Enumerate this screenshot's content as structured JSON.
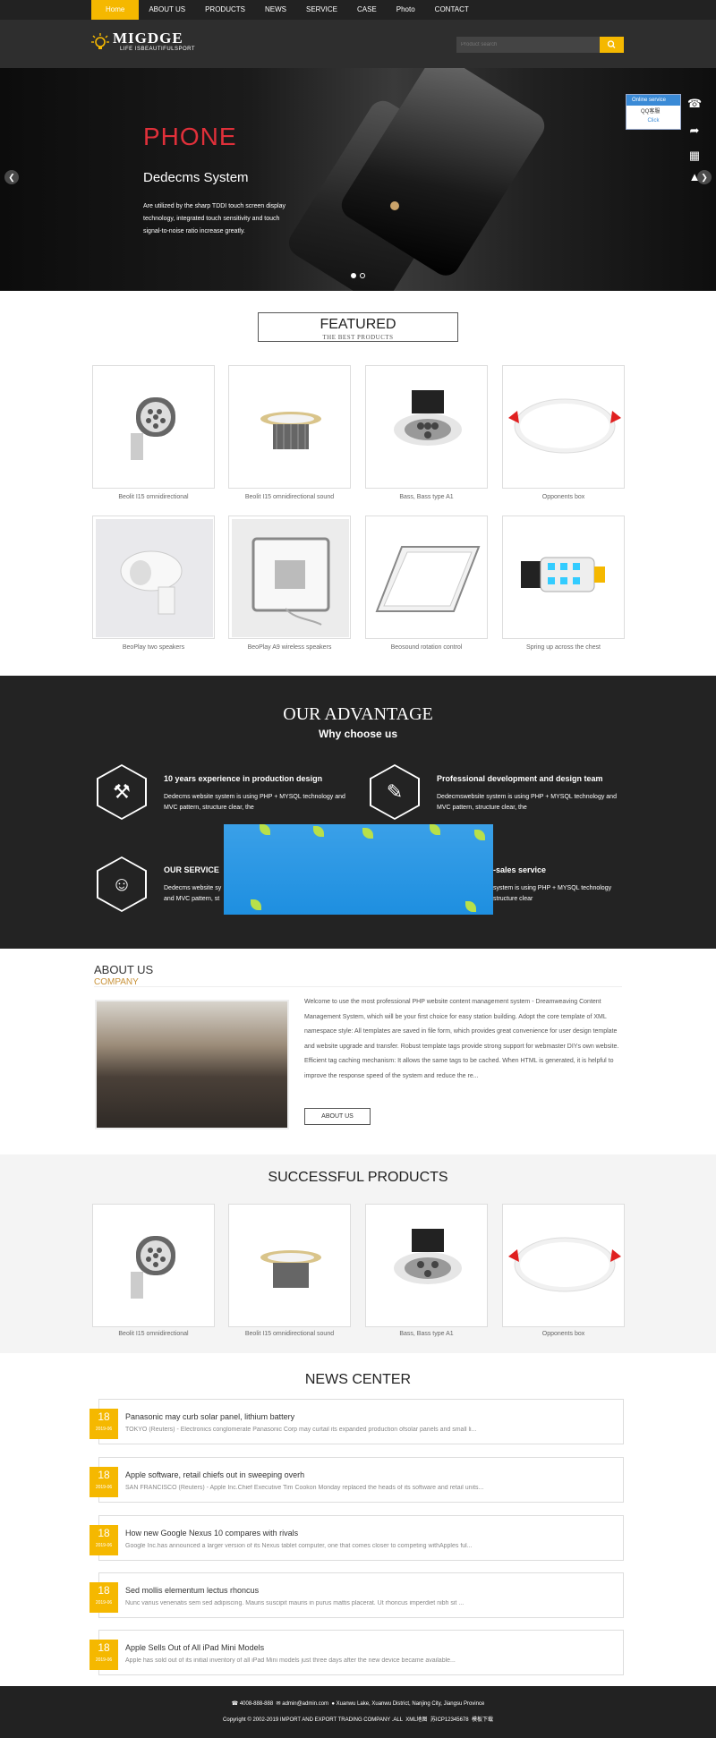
{
  "nav": {
    "items": [
      "Home",
      "ABOUT US",
      "PRODUCTS",
      "NEWS",
      "SERVICE",
      "CASE",
      "Photo",
      "CONTACT"
    ]
  },
  "logo": {
    "name": "MIGDGE",
    "sub": "LIFE ISBEAUTIFULSPORT"
  },
  "search": {
    "placeholder": "Product search"
  },
  "banner": {
    "title": "PHONE",
    "subtitle": "Dedecms System",
    "text": "Are utilized by the sharp TDDI touch screen display technology, integrated touch sensitivity and touch signal-to-noise ratio increase greatly."
  },
  "online": {
    "head": "Online service",
    "qq": "QQ客服",
    "click": "Click"
  },
  "featured": {
    "title": "FEATURED",
    "sub": "THE BEST PRODUCTS",
    "products": [
      {
        "name": "Beolit I15 omnidirectional",
        "icon": "floodlight-icon"
      },
      {
        "name": "Beolit I15 omnidirectional sound",
        "icon": "downlight-gold-icon"
      },
      {
        "name": "Bass, Bass type A1",
        "icon": "downlight-black-icon"
      },
      {
        "name": "Opponents box",
        "icon": "panel-round-icon"
      },
      {
        "name": "BeoPlay two speakers",
        "icon": "spotlight-white-icon"
      },
      {
        "name": "BeoPlay A9 wireless speakers",
        "icon": "floodlight-flat-icon"
      },
      {
        "name": "Beosound rotation control",
        "icon": "panel-rect-icon"
      },
      {
        "name": "Spring up across the chest",
        "icon": "led-bulb-icon"
      }
    ]
  },
  "advantage": {
    "title": "OUR ADVANTAGE",
    "sub": "Why choose us",
    "items": [
      {
        "h": "10 years experience in production design",
        "p": "Dedecms website system is using PHP + MYSQL technology and MVC pattern, structure clear, the"
      },
      {
        "h": "Professional development and design team",
        "p": "Dedecmswebsite system is using PHP + MYSQL technology and MVC pattern, structure clear, the"
      },
      {
        "h": "OUR SERVICE",
        "p": "Dedecms website sy\nand MVC pattern, st"
      },
      {
        "h": "-sales service",
        "p": "system is using PHP + MYSQL technology\nstructure clear"
      }
    ]
  },
  "about": {
    "title": "ABOUT US",
    "sub": "COMPANY",
    "text": "Welcome to use the most professional PHP website content management system - Dreamweaving Content Management System, which will be your first choice for easy station building. Adopt the core template of XML namespace style: All templates are saved in file form, which provides great convenience for user design template and website upgrade and transfer. Robust template tags provide strong support for webmaster DIYs own website. Efficient tag caching mechanism: It allows the same tags to be cached. When HTML is generated, it is helpful to improve the response speed of the system and reduce the re...",
    "button": "ABOUT US"
  },
  "successful": {
    "title": "SUCCESSFUL PRODUCTS",
    "products": [
      {
        "name": "Beolit I15 omnidirectional",
        "icon": "floodlight-icon"
      },
      {
        "name": "Beolit I15 omnidirectional sound",
        "icon": "downlight-gold-icon"
      },
      {
        "name": "Bass, Bass type A1",
        "icon": "downlight-black-icon"
      },
      {
        "name": "Opponents box",
        "icon": "panel-round-icon"
      }
    ]
  },
  "news": {
    "title": "NEWS CENTER",
    "items": [
      {
        "day": "18",
        "ym": "2019-06",
        "h": "Panasonic may curb solar panel, lithium battery",
        "p": "TOKYO (Reuters) - Electronics conglomerate Panasonic Corp may curtail its expanded production ofsolar panels and small li..."
      },
      {
        "day": "18",
        "ym": "2019-06",
        "h": "Apple software, retail chiefs out in sweeping overh",
        "p": "SAN FRANCISCO (Reuters) - Apple Inc.Chief Executive Tim Cookon Monday replaced the heads of its software and retail units..."
      },
      {
        "day": "18",
        "ym": "2019-06",
        "h": "How new Google Nexus 10 compares with rivals",
        "p": "Google Inc.has announced a larger version of its Nexus tablet computer, one that comes closer to competing withApples ful..."
      },
      {
        "day": "18",
        "ym": "2019-06",
        "h": "Sed mollis elementum lectus rhoncus",
        "p": "Nunc varius venenatis sem sed adipiscing. Mauris suscipit mauris in purus mattis placerat. Ut rhoncus imperdiet nibh sit ..."
      },
      {
        "day": "18",
        "ym": "2019-06",
        "h": "Apple Sells Out of All iPad Mini Models",
        "p": "Apple has sold out of its initial inventory of all iPad Mini models just three days after the new device became available..."
      }
    ]
  },
  "footer": {
    "phone": "4008-888-888",
    "email": "admin@admin.com",
    "address": "Xuanwu Lake, Xuanwu District, Nanjing City, Jiangsu Province",
    "copyright": "Copyright © 2002-2019 IMPORT AND EXPORT TRADING COMPANY .ALL",
    "sitemap": "XML地图",
    "icp": "苏ICP12345678",
    "tpl": "模板下载"
  },
  "colors": {
    "accent": "#f5b800",
    "dark": "#232323",
    "banner_red": "#e0303a"
  }
}
